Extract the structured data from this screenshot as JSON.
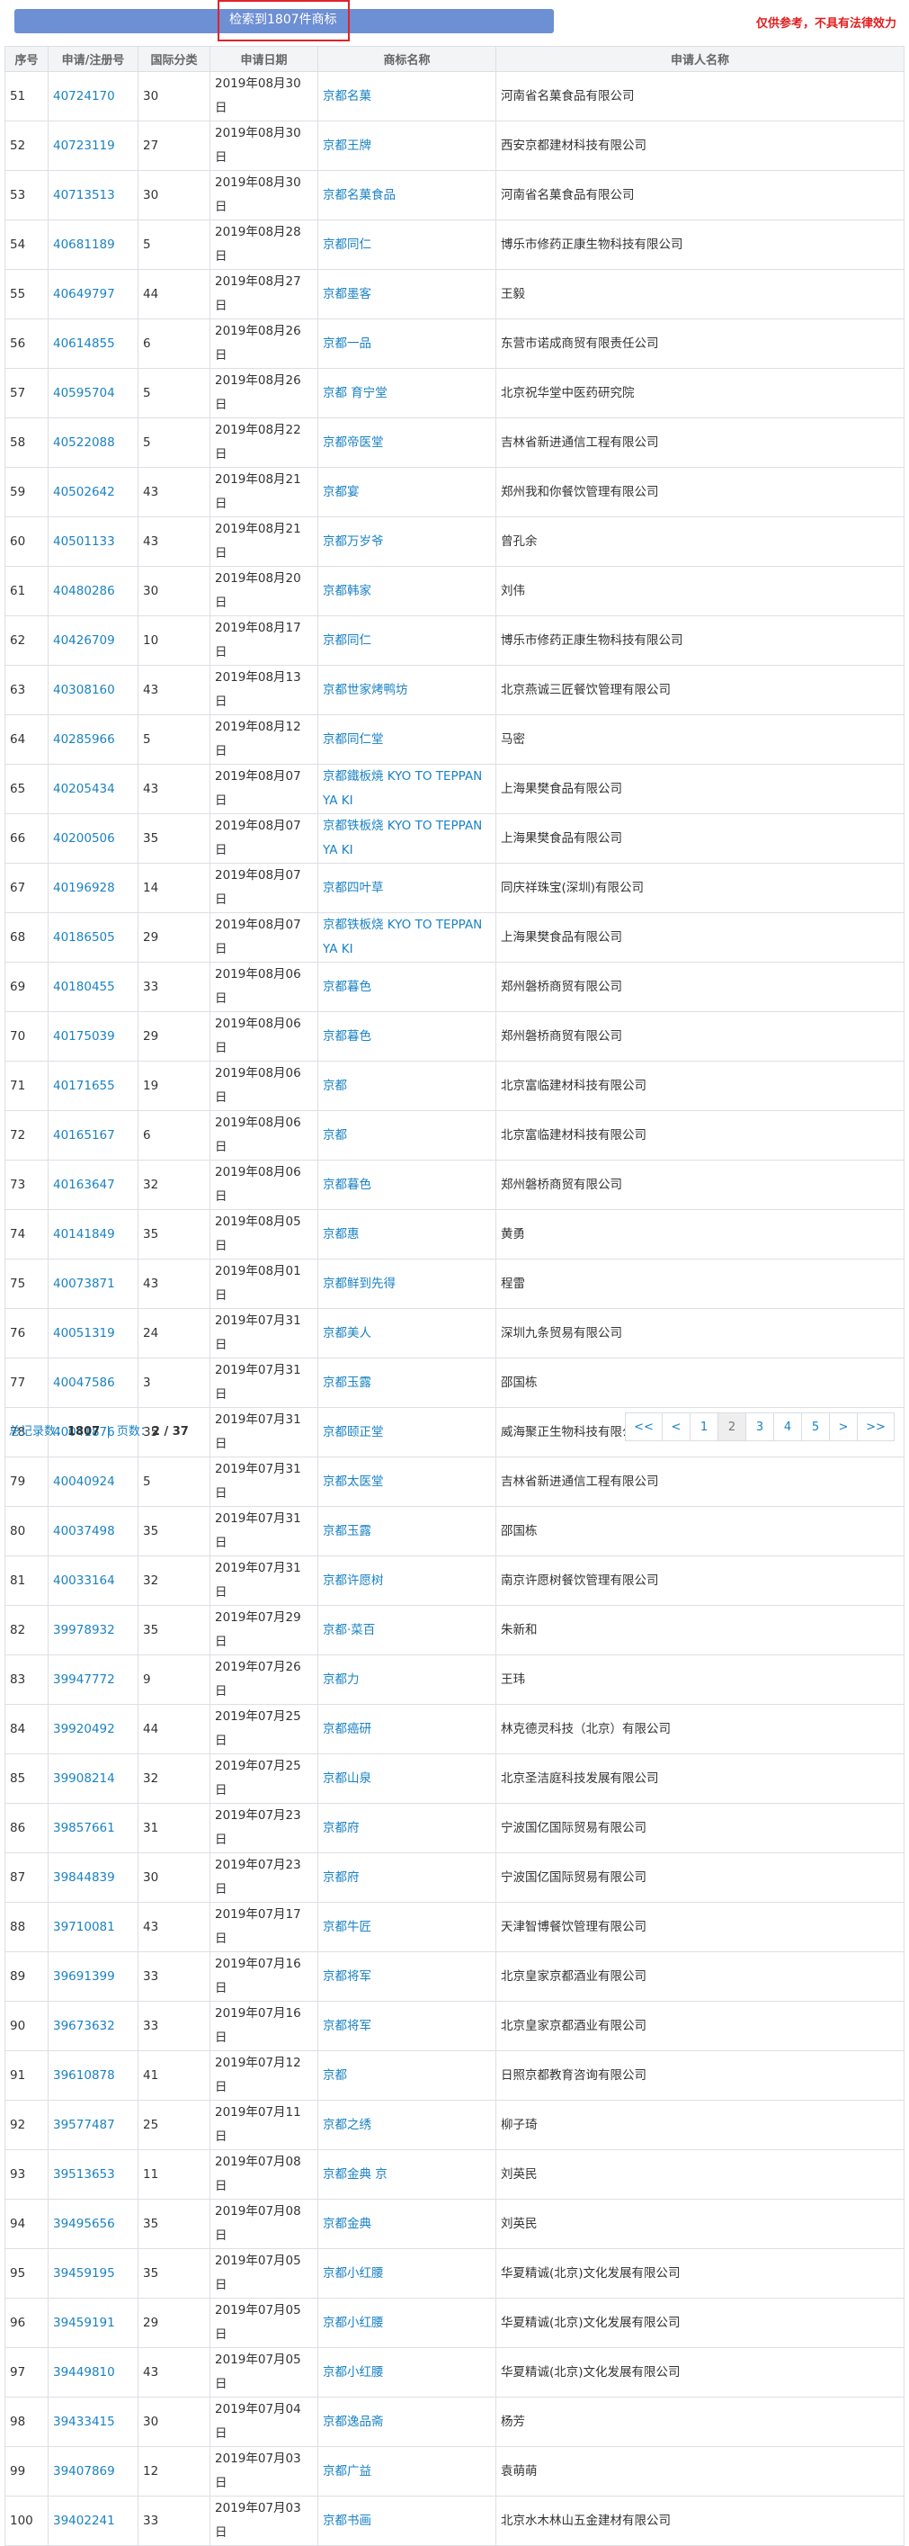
{
  "header": {
    "result_text": "检索到1807件商标",
    "disclaimer": "仅供参考，不具有法律效力"
  },
  "table": {
    "columns": [
      "序号",
      "申请/注册号",
      "国际分类",
      "申请日期",
      "商标名称",
      "申请人名称"
    ],
    "rows": [
      [
        "51",
        "40724170",
        "30",
        "2019年08月30日",
        "京都名菓",
        "河南省名菓食品有限公司"
      ],
      [
        "52",
        "40723119",
        "27",
        "2019年08月30日",
        "京都王牌",
        "西安京都建材科技有限公司"
      ],
      [
        "53",
        "40713513",
        "30",
        "2019年08月30日",
        "京都名菓食品",
        "河南省名菓食品有限公司"
      ],
      [
        "54",
        "40681189",
        "5",
        "2019年08月28日",
        "京都同仁",
        "博乐市修药正康生物科技有限公司"
      ],
      [
        "55",
        "40649797",
        "44",
        "2019年08月27日",
        "京都墨客",
        "王毅"
      ],
      [
        "56",
        "40614855",
        "6",
        "2019年08月26日",
        "京都一品",
        "东营市诺成商贸有限责任公司"
      ],
      [
        "57",
        "40595704",
        "5",
        "2019年08月26日",
        "京都 育宁堂",
        "北京祝华堂中医药研究院"
      ],
      [
        "58",
        "40522088",
        "5",
        "2019年08月22日",
        "京都帝医堂",
        "吉林省新进通信工程有限公司"
      ],
      [
        "59",
        "40502642",
        "43",
        "2019年08月21日",
        "京都宴",
        "郑州我和你餐饮管理有限公司"
      ],
      [
        "60",
        "40501133",
        "43",
        "2019年08月21日",
        "京都万岁爷",
        "曾孔余"
      ],
      [
        "61",
        "40480286",
        "30",
        "2019年08月20日",
        "京都韩家",
        "刘伟"
      ],
      [
        "62",
        "40426709",
        "10",
        "2019年08月17日",
        "京都同仁",
        "博乐市修药正康生物科技有限公司"
      ],
      [
        "63",
        "40308160",
        "43",
        "2019年08月13日",
        "京都世家烤鸭坊",
        "北京燕诚三匠餐饮管理有限公司"
      ],
      [
        "64",
        "40285966",
        "5",
        "2019年08月12日",
        "京都同仁堂",
        "马密"
      ],
      [
        "65",
        "40205434",
        "43",
        "2019年08月07日",
        "京都鐵板焼 KYO TO TEPPAN YA KI",
        "上海果樊食品有限公司"
      ],
      [
        "66",
        "40200506",
        "35",
        "2019年08月07日",
        "京都铁板烧 KYO TO TEPPAN YA KI",
        "上海果樊食品有限公司"
      ],
      [
        "67",
        "40196928",
        "14",
        "2019年08月07日",
        "京都四叶草",
        "同庆祥珠宝(深圳)有限公司"
      ],
      [
        "68",
        "40186505",
        "29",
        "2019年08月07日",
        "京都铁板烧 KYO TO TEPPAN YA KI",
        "上海果樊食品有限公司"
      ],
      [
        "69",
        "40180455",
        "33",
        "2019年08月06日",
        "京都暮色",
        "郑州磐桥商贸有限公司"
      ],
      [
        "70",
        "40175039",
        "29",
        "2019年08月06日",
        "京都暮色",
        "郑州磐桥商贸有限公司"
      ],
      [
        "71",
        "40171655",
        "19",
        "2019年08月06日",
        "京都",
        "北京富临建材科技有限公司"
      ],
      [
        "72",
        "40165167",
        "6",
        "2019年08月06日",
        "京都",
        "北京富临建材科技有限公司"
      ],
      [
        "73",
        "40163647",
        "32",
        "2019年08月06日",
        "京都暮色",
        "郑州磐桥商贸有限公司"
      ],
      [
        "74",
        "40141849",
        "35",
        "2019年08月05日",
        "京都惠",
        "黄勇"
      ],
      [
        "75",
        "40073871",
        "43",
        "2019年08月01日",
        "京都鲜到先得",
        "程雷"
      ],
      [
        "76",
        "40051319",
        "24",
        "2019年07月31日",
        "京都美人",
        "深圳九条贸易有限公司"
      ],
      [
        "77",
        "40047586",
        "3",
        "2019年07月31日",
        "京都玉露",
        "邵国栋"
      ],
      [
        "78",
        "40041876",
        "35",
        "2019年07月31日",
        "京都颐正堂",
        "威海聚正生物科技有限公司"
      ],
      [
        "79",
        "40040924",
        "5",
        "2019年07月31日",
        "京都太医堂",
        "吉林省新进通信工程有限公司"
      ],
      [
        "80",
        "40037498",
        "35",
        "2019年07月31日",
        "京都玉露",
        "邵国栋"
      ],
      [
        "81",
        "40033164",
        "32",
        "2019年07月31日",
        "京都许愿树",
        "南京许愿树餐饮管理有限公司"
      ],
      [
        "82",
        "39978932",
        "35",
        "2019年07月29日",
        "京都·菜百",
        "朱新和"
      ],
      [
        "83",
        "39947772",
        "9",
        "2019年07月26日",
        "京都力",
        "王玮"
      ],
      [
        "84",
        "39920492",
        "44",
        "2019年07月25日",
        "京都癌研",
        "林克德灵科技（北京）有限公司"
      ],
      [
        "85",
        "39908214",
        "32",
        "2019年07月25日",
        "京都山泉",
        "北京圣洁庭科技发展有限公司"
      ],
      [
        "86",
        "39857661",
        "31",
        "2019年07月23日",
        "京都府",
        "宁波国亿国际贸易有限公司"
      ],
      [
        "87",
        "39844839",
        "30",
        "2019年07月23日",
        "京都府",
        "宁波国亿国际贸易有限公司"
      ],
      [
        "88",
        "39710081",
        "43",
        "2019年07月17日",
        "京都牛匠",
        "天津智博餐饮管理有限公司"
      ],
      [
        "89",
        "39691399",
        "33",
        "2019年07月16日",
        "京都将军",
        "北京皇家京都酒业有限公司"
      ],
      [
        "90",
        "39673632",
        "33",
        "2019年07月16日",
        "京都将军",
        "北京皇家京都酒业有限公司"
      ],
      [
        "91",
        "39610878",
        "41",
        "2019年07月12日",
        "京都",
        "日照京都教育咨询有限公司"
      ],
      [
        "92",
        "39577487",
        "25",
        "2019年07月11日",
        "京都之绣",
        "柳子琦"
      ],
      [
        "93",
        "39513653",
        "11",
        "2019年07月08日",
        "京都金典 京",
        "刘英民"
      ],
      [
        "94",
        "39495656",
        "35",
        "2019年07月08日",
        "京都金典",
        "刘英民"
      ],
      [
        "95",
        "39459195",
        "35",
        "2019年07月05日",
        "京都小红腰",
        "华夏精诚(北京)文化发展有限公司"
      ],
      [
        "96",
        "39459191",
        "29",
        "2019年07月05日",
        "京都小红腰",
        "华夏精诚(北京)文化发展有限公司"
      ],
      [
        "97",
        "39449810",
        "43",
        "2019年07月05日",
        "京都小红腰",
        "华夏精诚(北京)文化发展有限公司"
      ],
      [
        "98",
        "39433415",
        "30",
        "2019年07月04日",
        "京都逸品斋",
        "杨芳"
      ],
      [
        "99",
        "39407869",
        "12",
        "2019年07月03日",
        "京都广益",
        "袁萌萌"
      ],
      [
        "100",
        "39402241",
        "33",
        "2019年07月03日",
        "京都书画",
        "北京水木林山五金建材有限公司"
      ]
    ]
  },
  "footer": {
    "total_label": "总记录数：",
    "total_value": "1807",
    "separator": "|",
    "pages_label": "页数：",
    "pages_value": "2 / 37"
  },
  "pagination": {
    "first": "<<",
    "prev": "<",
    "pages": [
      "1",
      "2",
      "3",
      "4",
      "5"
    ],
    "current": "2",
    "next": ">",
    "last": ">>"
  },
  "colors": {
    "bar": "#6d8fd4",
    "link": "#1a82c4",
    "alert": "#e01e1e",
    "highlight_border": "#e0232b"
  }
}
